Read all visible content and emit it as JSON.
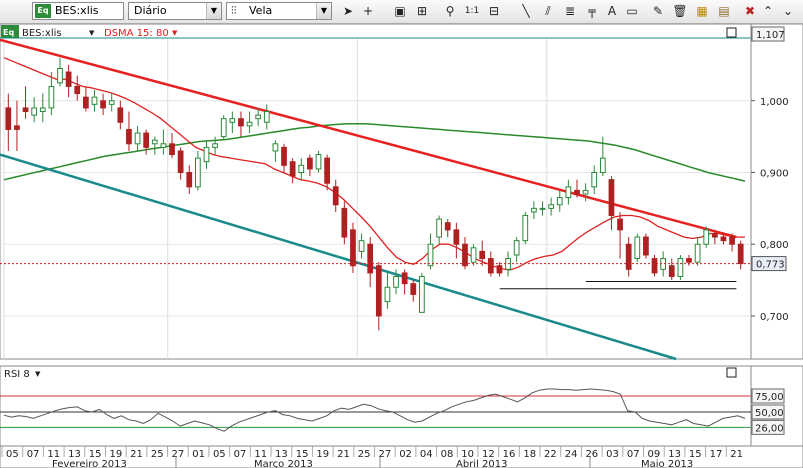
{
  "toolbar": {
    "symbol": "BES:xlis",
    "period": "Diário",
    "chart_style": "Vela",
    "zoom_label": "1:1",
    "tool_icons": [
      "cursor-arrow-icon",
      "crosshair-icon",
      "info-icon",
      "grid-icon",
      "zoom-icon",
      "zoom-1-1",
      "trendline-icon",
      "channel-icon",
      "fib-icon",
      "ruler-icon",
      "text-icon",
      "shape-icon",
      "pencil-icon",
      "trash-icon",
      "color-icon",
      "close-icon"
    ]
  },
  "price_panel": {
    "symbol_label": "BES:xlis",
    "indicator_label": "DSMA 15: 80",
    "current_price_label": "0,773",
    "top_price_label": "1,107"
  },
  "rsi_panel": {
    "label": "RSI 8",
    "levels": [
      {
        "label": "75,00",
        "value": 75,
        "color": "#d03030"
      },
      {
        "label": "50,00",
        "value": 50,
        "color": "#333333"
      },
      {
        "label": "26,00",
        "value": 26,
        "color": "#2a9a3a"
      }
    ]
  },
  "colors": {
    "up_candle": "#2a8a3a",
    "down_candle": "#b02020",
    "sma_fast": "#e02020",
    "sma_slow": "#2a8a2a",
    "trend_red": "#e82020",
    "trend_teal": "#1a8a8a",
    "price_marker": "#e8eef8"
  },
  "chart_data": [
    {
      "type": "candlestick",
      "title": "BES:xlis Diário",
      "ylim": [
        0.64,
        1.107
      ],
      "y_ticks": [
        "1,000",
        "0,900",
        "0,800",
        "0,700"
      ],
      "y_tick_values": [
        1.0,
        0.9,
        0.8,
        0.7
      ],
      "x_tick_labels": [
        "05",
        "07",
        "11",
        "13",
        "15",
        "19",
        "21",
        "25",
        "27",
        "01",
        "05",
        "07",
        "11",
        "13",
        "15",
        "19",
        "21",
        "25",
        "27",
        "02",
        "04",
        "08",
        "10",
        "12",
        "16",
        "18",
        "22",
        "24",
        "26",
        "03",
        "07",
        "09",
        "13",
        "15",
        "17",
        "21"
      ],
      "month_labels": [
        "Fevereiro 2013",
        "Março 2013",
        "Abril 2013",
        "Maio 2013"
      ],
      "candles": [
        [
          0.99,
          0.96,
          1.01,
          0.93
        ],
        [
          0.965,
          0.96,
          1.0,
          0.93
        ],
        [
          0.99,
          0.985,
          1.02,
          0.975
        ],
        [
          0.98,
          0.99,
          1.005,
          0.97
        ],
        [
          0.985,
          0.99,
          1.01,
          0.97
        ],
        [
          0.99,
          1.02,
          1.04,
          0.98
        ],
        [
          1.025,
          1.045,
          1.06,
          1.02
        ],
        [
          1.04,
          1.02,
          1.05,
          1.005
        ],
        [
          1.02,
          1.01,
          1.035,
          1.0
        ],
        [
          1.005,
          0.99,
          1.02,
          0.985
        ],
        [
          0.995,
          1.005,
          1.015,
          0.985
        ],
        [
          1.0,
          0.99,
          1.01,
          0.98
        ],
        [
          0.995,
          1.0,
          1.01,
          0.985
        ],
        [
          0.99,
          0.97,
          1.0,
          0.96
        ],
        [
          0.96,
          0.94,
          0.985,
          0.93
        ],
        [
          0.94,
          0.955,
          0.965,
          0.93
        ],
        [
          0.955,
          0.935,
          0.96,
          0.925
        ],
        [
          0.94,
          0.945,
          0.95,
          0.925
        ],
        [
          0.935,
          0.94,
          0.96,
          0.925
        ],
        [
          0.94,
          0.925,
          0.955,
          0.92
        ],
        [
          0.93,
          0.9,
          0.935,
          0.89
        ],
        [
          0.9,
          0.88,
          0.91,
          0.87
        ],
        [
          0.88,
          0.92,
          0.93,
          0.875
        ],
        [
          0.915,
          0.935,
          0.945,
          0.905
        ],
        [
          0.935,
          0.94,
          0.95,
          0.925
        ],
        [
          0.95,
          0.975,
          0.98,
          0.945
        ],
        [
          0.97,
          0.975,
          0.985,
          0.955
        ],
        [
          0.975,
          0.965,
          0.985,
          0.95
        ],
        [
          0.965,
          0.97,
          0.985,
          0.955
        ],
        [
          0.975,
          0.98,
          0.99,
          0.965
        ],
        [
          0.97,
          0.985,
          0.995,
          0.96
        ],
        [
          0.93,
          0.94,
          0.945,
          0.915
        ],
        [
          0.935,
          0.91,
          0.94,
          0.9
        ],
        [
          0.915,
          0.895,
          0.92,
          0.885
        ],
        [
          0.9,
          0.91,
          0.92,
          0.89
        ],
        [
          0.92,
          0.905,
          0.925,
          0.895
        ],
        [
          0.905,
          0.925,
          0.93,
          0.9
        ],
        [
          0.92,
          0.885,
          0.925,
          0.875
        ],
        [
          0.88,
          0.855,
          0.89,
          0.845
        ],
        [
          0.85,
          0.81,
          0.86,
          0.8
        ],
        [
          0.82,
          0.77,
          0.83,
          0.76
        ],
        [
          0.79,
          0.805,
          0.815,
          0.78
        ],
        [
          0.8,
          0.76,
          0.81,
          0.74
        ],
        [
          0.77,
          0.7,
          0.775,
          0.68
        ],
        [
          0.72,
          0.74,
          0.76,
          0.71
        ],
        [
          0.74,
          0.755,
          0.765,
          0.73
        ],
        [
          0.76,
          0.745,
          0.765,
          0.73
        ],
        [
          0.745,
          0.73,
          0.75,
          0.72
        ],
        [
          0.705,
          0.755,
          0.76,
          0.705
        ],
        [
          0.77,
          0.8,
          0.815,
          0.765
        ],
        [
          0.81,
          0.835,
          0.84,
          0.8
        ],
        [
          0.83,
          0.82,
          0.835,
          0.81
        ],
        [
          0.82,
          0.8,
          0.83,
          0.78
        ],
        [
          0.8,
          0.77,
          0.81,
          0.765
        ],
        [
          0.775,
          0.795,
          0.8,
          0.77
        ],
        [
          0.79,
          0.78,
          0.805,
          0.77
        ],
        [
          0.78,
          0.76,
          0.79,
          0.755
        ],
        [
          0.77,
          0.76,
          0.775,
          0.755
        ],
        [
          0.765,
          0.78,
          0.79,
          0.755
        ],
        [
          0.785,
          0.805,
          0.81,
          0.775
        ],
        [
          0.805,
          0.84,
          0.845,
          0.8
        ],
        [
          0.845,
          0.85,
          0.86,
          0.835
        ],
        [
          0.85,
          0.85,
          0.86,
          0.84
        ],
        [
          0.85,
          0.855,
          0.865,
          0.84
        ],
        [
          0.855,
          0.865,
          0.875,
          0.845
        ],
        [
          0.865,
          0.88,
          0.89,
          0.855
        ],
        [
          0.875,
          0.87,
          0.89,
          0.865
        ],
        [
          0.87,
          0.875,
          0.885,
          0.86
        ],
        [
          0.88,
          0.9,
          0.91,
          0.87
        ],
        [
          0.9,
          0.92,
          0.95,
          0.895
        ],
        [
          0.89,
          0.84,
          0.895,
          0.82
        ],
        [
          0.835,
          0.82,
          0.845,
          0.78
        ],
        [
          0.8,
          0.765,
          0.81,
          0.755
        ],
        [
          0.78,
          0.81,
          0.815,
          0.775
        ],
        [
          0.81,
          0.785,
          0.815,
          0.78
        ],
        [
          0.78,
          0.76,
          0.785,
          0.755
        ],
        [
          0.765,
          0.78,
          0.79,
          0.755
        ],
        [
          0.77,
          0.755,
          0.78,
          0.75
        ],
        [
          0.755,
          0.78,
          0.785,
          0.75
        ],
        [
          0.78,
          0.775,
          0.785,
          0.77
        ],
        [
          0.775,
          0.8,
          0.81,
          0.77
        ],
        [
          0.8,
          0.82,
          0.825,
          0.795
        ],
        [
          0.815,
          0.81,
          0.82,
          0.8
        ],
        [
          0.81,
          0.805,
          0.815,
          0.8
        ],
        [
          0.81,
          0.8,
          0.815,
          0.79
        ],
        [
          0.8,
          0.773,
          0.805,
          0.765
        ]
      ],
      "sma_fast": [
        1.06,
        1.055,
        1.05,
        1.045,
        1.04,
        1.035,
        1.03,
        1.03,
        1.025,
        1.02,
        1.018,
        1.015,
        1.012,
        1.008,
        1.003,
        0.997,
        0.99,
        0.983,
        0.975,
        0.965,
        0.955,
        0.945,
        0.935,
        0.93,
        0.925,
        0.922,
        0.92,
        0.918,
        0.916,
        0.914,
        0.912,
        0.905,
        0.9,
        0.895,
        0.89,
        0.888,
        0.885,
        0.88,
        0.872,
        0.862,
        0.85,
        0.838,
        0.825,
        0.81,
        0.795,
        0.782,
        0.775,
        0.772,
        0.78,
        0.792,
        0.8,
        0.8,
        0.795,
        0.788,
        0.78,
        0.775,
        0.77,
        0.766,
        0.764,
        0.768,
        0.775,
        0.78,
        0.783,
        0.785,
        0.79,
        0.8,
        0.81,
        0.818,
        0.825,
        0.832,
        0.838,
        0.84,
        0.84,
        0.838,
        0.833,
        0.825,
        0.82,
        0.815,
        0.81,
        0.808,
        0.81,
        0.815,
        0.815,
        0.812,
        0.81,
        0.81
      ],
      "sma_slow": [
        0.89,
        0.893,
        0.896,
        0.899,
        0.902,
        0.905,
        0.908,
        0.911,
        0.914,
        0.917,
        0.92,
        0.923,
        0.925,
        0.927,
        0.929,
        0.931,
        0.933,
        0.935,
        0.937,
        0.939,
        0.941,
        0.943,
        0.944,
        0.945,
        0.946,
        0.948,
        0.95,
        0.952,
        0.954,
        0.956,
        0.958,
        0.96,
        0.962,
        0.963,
        0.965,
        0.966,
        0.967,
        0.968,
        0.968,
        0.968,
        0.967,
        0.966,
        0.965,
        0.964,
        0.963,
        0.962,
        0.961,
        0.96,
        0.959,
        0.958,
        0.957,
        0.956,
        0.955,
        0.954,
        0.953,
        0.952,
        0.951,
        0.95,
        0.949,
        0.948,
        0.947,
        0.946,
        0.945,
        0.944,
        0.942,
        0.94,
        0.938,
        0.935,
        0.932,
        0.928,
        0.924,
        0.92,
        0.916,
        0.912,
        0.908,
        0.904,
        0.9,
        0.897,
        0.894,
        0.891,
        0.888
      ],
      "trendlines": [
        {
          "name": "resistance",
          "x": [
            0,
            85
          ],
          "y": [
            1.085,
            0.81
          ]
        },
        {
          "name": "support",
          "x": [
            0,
            78
          ],
          "y": [
            0.925,
            0.64
          ]
        },
        {
          "name": "support-short-1",
          "x": [
            68,
            85
          ],
          "y": [
            0.748,
            0.748
          ]
        },
        {
          "name": "support-short-2",
          "x": [
            58,
            85
          ],
          "y": [
            0.738,
            0.738
          ]
        }
      ]
    },
    {
      "type": "line",
      "title": "RSI 8",
      "ylim": [
        0,
        100
      ],
      "y_ticks": [
        "75,00",
        "50,00",
        "26,00"
      ],
      "values": [
        45,
        42,
        44,
        43,
        40,
        44,
        48,
        52,
        55,
        57,
        58,
        52,
        50,
        54,
        46,
        40,
        44,
        38,
        36,
        32,
        38,
        48,
        42,
        36,
        28,
        32,
        36,
        33,
        30,
        24,
        20,
        28,
        34,
        38,
        42,
        46,
        50,
        52,
        46,
        44,
        40,
        38,
        36,
        40,
        44,
        52,
        56,
        54,
        58,
        62,
        60,
        55,
        52,
        50,
        44,
        38,
        34,
        36,
        42,
        48,
        52,
        58,
        62,
        66,
        68,
        72,
        76,
        78,
        74,
        70,
        66,
        72,
        80,
        84,
        86,
        86,
        85,
        85,
        84,
        85,
        86,
        85,
        84,
        82,
        78,
        52,
        50,
        40,
        36,
        34,
        32,
        30,
        34,
        38,
        32,
        30,
        28,
        34,
        40,
        42,
        44,
        40
      ]
    }
  ]
}
